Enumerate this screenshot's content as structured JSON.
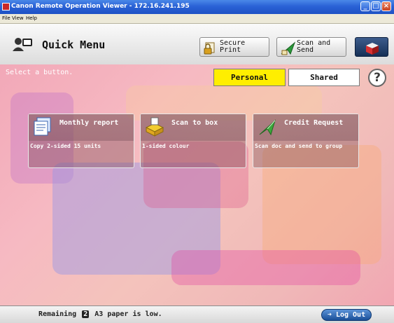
{
  "window": {
    "title": "Canon Remote Operation Viewer - 172.16.241.195",
    "controls": [
      "minimize-icon",
      "maximize-icon",
      "close-icon"
    ]
  },
  "menubar": {
    "items": [
      "File",
      "View",
      "Help"
    ]
  },
  "header": {
    "title": "Quick Menu",
    "buttons": {
      "secure_print": {
        "label_line1": "Secure",
        "label_line2": "Print"
      },
      "scan_send": {
        "label_line1": "Scan and",
        "label_line2": "Send"
      }
    }
  },
  "main": {
    "prompt": "Select a button.",
    "tabs": {
      "personal": "Personal",
      "shared": "Shared"
    },
    "help_label": "?",
    "buttons": [
      {
        "title": "Monthly report",
        "desc": "Copy 2-sided 15 units",
        "icon": "copy-icon"
      },
      {
        "title": "Scan to box",
        "desc": "1-sided colour",
        "icon": "scan-to-box-icon"
      },
      {
        "title": "Credit Request",
        "desc": "Scan doc and send to group",
        "icon": "scan-send-icon"
      }
    ]
  },
  "status": {
    "prefix": "Remaining",
    "tray": "2",
    "message": "A3  paper is low.",
    "logout_label": "Log Out"
  },
  "colors": {
    "titlebar": "#2a62d6",
    "selected_tab": "#ffee00",
    "logout": "#1a4f98"
  }
}
